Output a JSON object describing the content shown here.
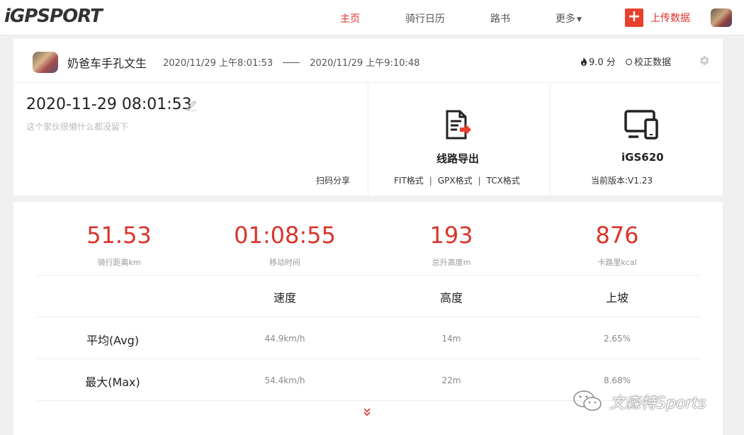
{
  "brand": {
    "logo_text": "iGPSPORT"
  },
  "nav": {
    "items": [
      {
        "label": "主页",
        "active": true
      },
      {
        "label": "骑行日历",
        "active": false
      },
      {
        "label": "路书",
        "active": false
      },
      {
        "label": "更多",
        "active": false
      }
    ],
    "upload_label": "上传数据"
  },
  "ride": {
    "user_name": "奶爸车手孔文生",
    "start_time": "2020/11/29 上午8:01:53",
    "end_time": "2020/11/29 上午9:10:48",
    "score": "9.0 分",
    "calibrate_label": "校正数据",
    "title": "2020-11-29 08:01:53",
    "description": "这个家伙很懒什么都没留下",
    "share_label": "扫码分享"
  },
  "export": {
    "title": "线路导出",
    "formats": [
      "FIT格式",
      "GPX格式",
      "TCX格式"
    ]
  },
  "device": {
    "name": "iGS620",
    "version": "当前版本:V1.23"
  },
  "stats": [
    {
      "value": "51.53",
      "label": "骑行距离km"
    },
    {
      "value": "01:08:55",
      "label": "移动时间"
    },
    {
      "value": "193",
      "label": "总升高度m"
    },
    {
      "value": "876",
      "label": "卡路里kcal"
    }
  ],
  "table": {
    "headers": [
      "速度",
      "高度",
      "上坡"
    ],
    "rows": [
      {
        "label": "平均(Avg)",
        "values": [
          "44.9km/h",
          "14m",
          "2.65%"
        ]
      },
      {
        "label": "最大(Max)",
        "values": [
          "54.4km/h",
          "22m",
          "8.68%"
        ]
      }
    ]
  },
  "watermark": {
    "text": "文森特Sports"
  },
  "colors": {
    "accent": "#e0302a",
    "stat": "#d9342b"
  }
}
